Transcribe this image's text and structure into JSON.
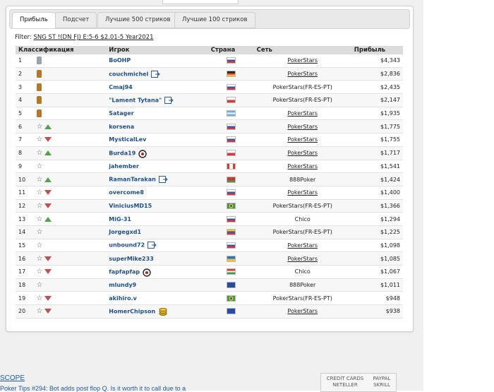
{
  "tabs": [
    {
      "label": "Прибыль",
      "active": true
    },
    {
      "label": "Подсчет",
      "active": false
    },
    {
      "label": "Лучшие 500 стриков",
      "active": false
    },
    {
      "label": "Лучшие 100 стриков",
      "active": false
    }
  ],
  "filter": {
    "label": "Filter:",
    "value": "SNG ST !(DN FJ) E:5-6 $2.01-5 Year2021"
  },
  "table": {
    "headers": {
      "rank": "Классификация",
      "player": "Игрок",
      "country": "Страна",
      "network": "Сеть",
      "profit": "Прибыль"
    },
    "rows": [
      {
        "rank": "1",
        "player": "BoOHP",
        "flag": "RU",
        "network": "PokerStars",
        "network_link": true,
        "profit": "$4,343",
        "icon": "trophy-silver",
        "trend": "none",
        "badge": ""
      },
      {
        "rank": "2",
        "player": "couchmichel",
        "flag": "DE",
        "network": "PokerStars",
        "network_link": true,
        "profit": "$2,836",
        "icon": "trophy-gold",
        "trend": "none",
        "badge": "card-icon"
      },
      {
        "rank": "3",
        "player": "Cmaj94",
        "flag": "RU",
        "network": "PokerStars(FR-ES-PT)",
        "network_link": false,
        "profit": "$2,435",
        "icon": "trophy-gold",
        "trend": "none",
        "badge": ""
      },
      {
        "rank": "4",
        "player": "\"Lament Tytana\"",
        "flag": "PL",
        "network": "PokerStars(FR-ES-PT)",
        "network_link": false,
        "profit": "$2,147",
        "icon": "trophy-gold",
        "trend": "none",
        "badge": "card-icon"
      },
      {
        "rank": "5",
        "player": "Satager",
        "flag": "AR",
        "network": "PokerStars",
        "network_link": true,
        "profit": "$1,935",
        "icon": "trophy-gold",
        "trend": "none",
        "badge": ""
      },
      {
        "rank": "6",
        "player": "korsena",
        "flag": "RU",
        "network": "PokerStars",
        "network_link": true,
        "profit": "$1,775",
        "icon": "star",
        "trend": "up",
        "badge": ""
      },
      {
        "rank": "7",
        "player": "MysticalLev",
        "flag": "RU",
        "network": "PokerStars",
        "network_link": true,
        "profit": "$1,755",
        "icon": "star",
        "trend": "down",
        "badge": ""
      },
      {
        "rank": "8",
        "player": "Burda19",
        "flag": "CZ",
        "network": "PokerStars",
        "network_link": true,
        "profit": "$1,717",
        "icon": "star",
        "trend": "up",
        "badge": "target-icon"
      },
      {
        "rank": "9",
        "player": "jahember",
        "flag": "CA",
        "network": "PokerStars",
        "network_link": true,
        "profit": "$1,541",
        "icon": "star",
        "trend": "none",
        "badge": ""
      },
      {
        "rank": "10",
        "player": "RamanTarakan",
        "flag": "BY",
        "network": "888Poker",
        "network_link": false,
        "profit": "$1,424",
        "icon": "star",
        "trend": "up",
        "badge": "card-icon"
      },
      {
        "rank": "11",
        "player": "overcome8",
        "flag": "RU",
        "network": "PokerStars",
        "network_link": true,
        "profit": "$1,400",
        "icon": "star",
        "trend": "down",
        "badge": ""
      },
      {
        "rank": "12",
        "player": "ViniciusMD15",
        "flag": "BR",
        "network": "PokerStars(FR-ES-PT)",
        "network_link": false,
        "profit": "$1,366",
        "icon": "star",
        "trend": "down",
        "badge": ""
      },
      {
        "rank": "13",
        "player": "MiG-31",
        "flag": "RU",
        "network": "Chico",
        "network_link": false,
        "profit": "$1,294",
        "icon": "star",
        "trend": "up",
        "badge": ""
      },
      {
        "rank": "14",
        "player": "Jorgegxd1",
        "flag": "VE",
        "network": "PokerStars(FR-ES-PT)",
        "network_link": false,
        "profit": "$1,225",
        "icon": "star",
        "trend": "none",
        "badge": ""
      },
      {
        "rank": "15",
        "player": "unbound72",
        "flag": "RU",
        "network": "PokerStars",
        "network_link": true,
        "profit": "$1,098",
        "icon": "star",
        "trend": "none",
        "badge": "card-icon"
      },
      {
        "rank": "16",
        "player": "superMike233",
        "flag": "UA",
        "network": "PokerStars",
        "network_link": true,
        "profit": "$1,085",
        "icon": "star",
        "trend": "down",
        "badge": ""
      },
      {
        "rank": "17",
        "player": "fapfapfap",
        "flag": "HU",
        "network": "Chico",
        "network_link": false,
        "profit": "$1,067",
        "icon": "star",
        "trend": "down",
        "badge": "target-icon"
      },
      {
        "rank": "18",
        "player": "mlundy9",
        "flag": "GB",
        "network": "888Poker",
        "network_link": false,
        "profit": "$1,011",
        "icon": "star",
        "trend": "none",
        "badge": ""
      },
      {
        "rank": "19",
        "player": "akihiro.v",
        "flag": "BR",
        "network": "PokerStars(FR-ES-PT)",
        "network_link": false,
        "profit": "$948",
        "icon": "star",
        "trend": "down",
        "badge": ""
      },
      {
        "rank": "20",
        "player": "HomerChipson",
        "flag": "GB",
        "network": "PokerStars",
        "network_link": true,
        "profit": "$938",
        "icon": "star",
        "trend": "down",
        "badge": "coins-icon"
      }
    ]
  },
  "footer": {
    "scope_link": "SCOPE",
    "tips_text": "Poker Tips #294: Bot adds post flop Q. Is it worth it to call due to a",
    "payments": [
      {
        "label": "CREDIT CARDS\nNETELLER"
      },
      {
        "label": "PAYPAL\nSKRILL"
      }
    ]
  },
  "colors": {
    "player_link": "#1e4f8a",
    "trend_up": "#53a24a",
    "trend_down": "#c05050",
    "header_bg": "#dcdcdc"
  }
}
